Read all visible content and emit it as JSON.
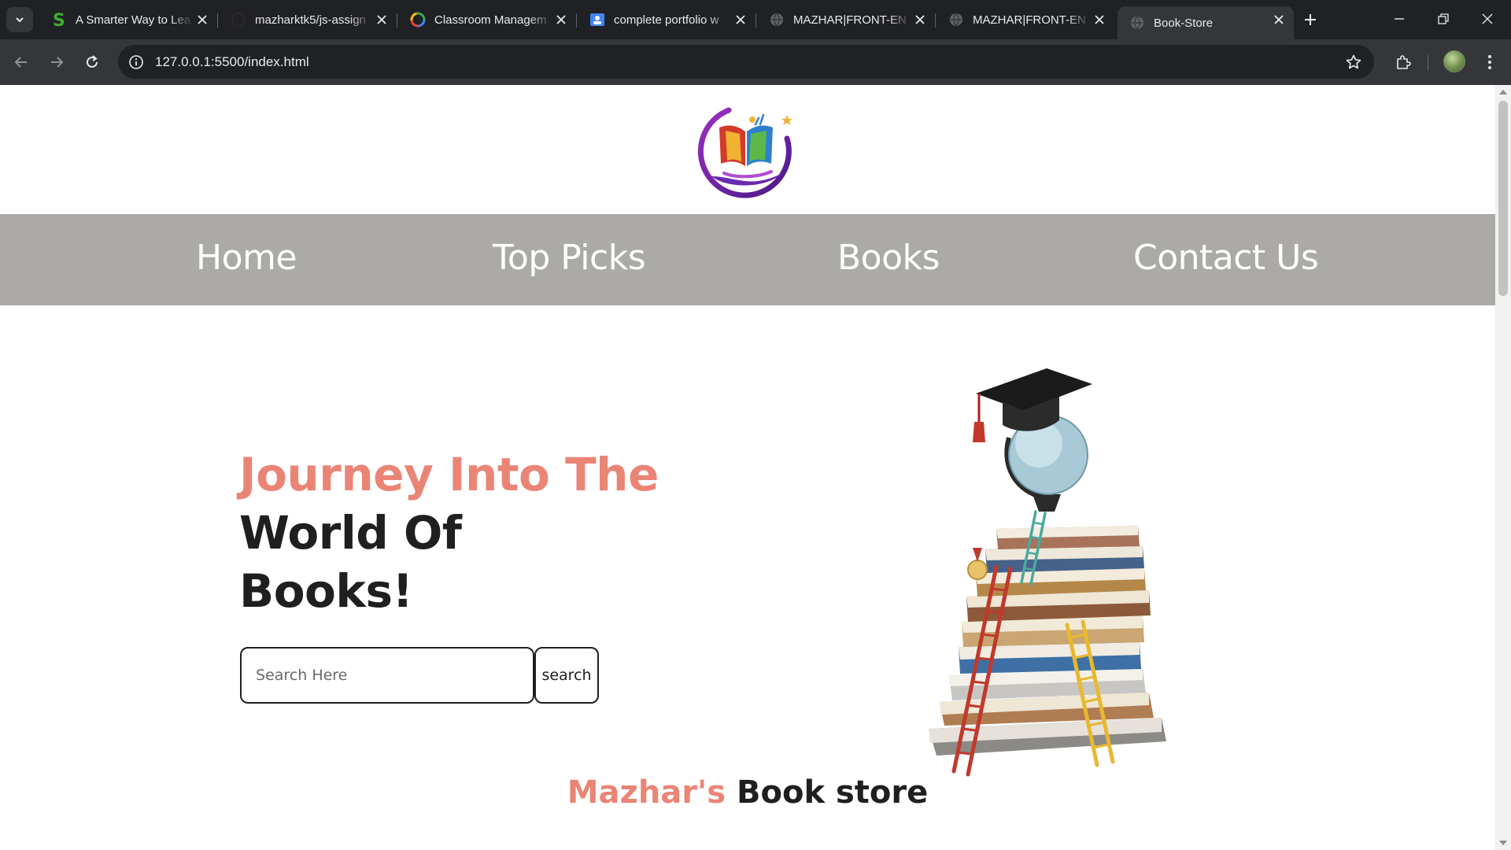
{
  "browser": {
    "tabs": [
      {
        "title": "A Smarter Way to Lea",
        "favicon": "s-green-icon"
      },
      {
        "title": "mazharktk5/js-assign",
        "favicon": "github-icon"
      },
      {
        "title": "Classroom Managem",
        "favicon": "google-icon"
      },
      {
        "title": "complete portfolio w",
        "favicon": "classroom-icon"
      },
      {
        "title": "MAZHAR|FRONT-EN",
        "favicon": "globe-icon"
      },
      {
        "title": "MAZHAR|FRONT-EN",
        "favicon": "globe-icon"
      },
      {
        "title": "Book-Store",
        "favicon": "globe-icon",
        "active": true
      }
    ],
    "url": "127.0.0.1:5500/index.html"
  },
  "nav": {
    "items": [
      {
        "label": "Home"
      },
      {
        "label": "Top Picks"
      },
      {
        "label": "Books"
      },
      {
        "label": "Contact Us"
      }
    ]
  },
  "hero": {
    "title_accent": "Journey Into The",
    "title_line2": "World Of",
    "title_line3": "Books!",
    "search_placeholder": "Search Here",
    "search_button": "search"
  },
  "store": {
    "name_accent": "Mazhar's",
    "name_rest": "Book store"
  },
  "colors": {
    "accent": "#ea8576",
    "navbar_bg": "#acaaa7",
    "text_dark": "#1f1f1f"
  }
}
